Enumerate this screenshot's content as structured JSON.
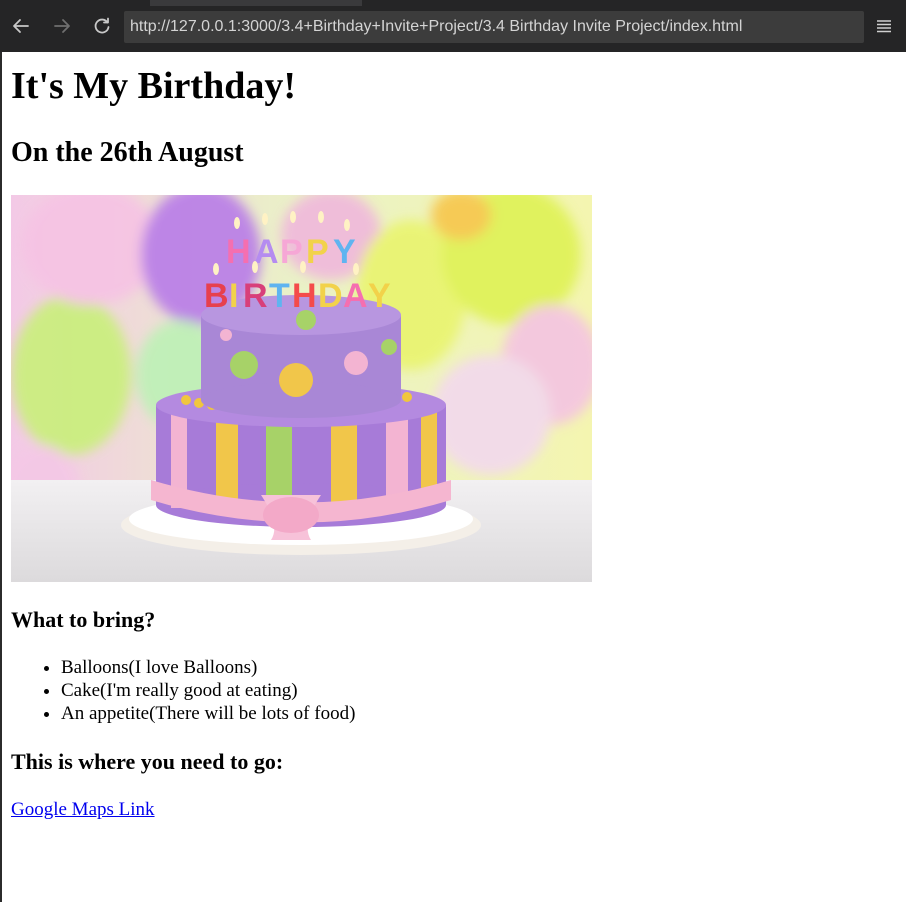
{
  "browser": {
    "url": "http://127.0.0.1:3000/3.4+Birthday+Invite+Project/3.4 Birthday Invite Project/index.html",
    "icons": {
      "back": "arrow-left-icon",
      "forward": "arrow-right-icon",
      "reload": "reload-icon",
      "menu": "hamburger-menu-icon"
    }
  },
  "page": {
    "title": "It's My Birthday!",
    "date_heading": "On the 26th August",
    "image": {
      "cake_letters_top": "HAPPY",
      "cake_letters_bottom": "BIRTHDAY"
    },
    "bring_heading": "What to bring?",
    "bring_items": [
      "Balloons(I love Balloons)",
      "Cake(I'm really good at eating)",
      "An appetite(There will be lots of food)"
    ],
    "where_heading": "This is where you need to go:",
    "maps_link": "Google Maps Link"
  },
  "colors": {
    "toolbar_bg": "#252526",
    "urlbar_bg": "#3c3c3c",
    "link": "#0000ee"
  }
}
